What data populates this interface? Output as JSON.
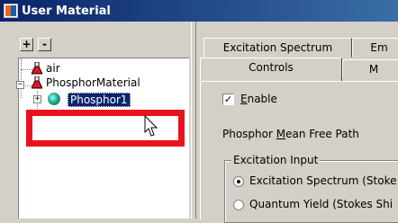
{
  "window": {
    "title": "User Material"
  },
  "tree_toolbar": {
    "expand_label": "+",
    "collapse_label": "-"
  },
  "tree": {
    "items": [
      {
        "label": "air"
      },
      {
        "label": "PhosphorMaterial"
      },
      {
        "label": "Phosphor1",
        "selected": true
      }
    ]
  },
  "tabs": {
    "row1": [
      "Excitation Spectrum",
      "Em"
    ],
    "row2": [
      "Controls",
      "M"
    ]
  },
  "controls": {
    "enable_label_prefix": "",
    "enable_label_accel": "E",
    "enable_label_rest": "nable",
    "enable_checked": true,
    "mfp_prefix": "Phosphor ",
    "mfp_accel": "M",
    "mfp_rest": "ean Free Path",
    "excitation_group_label": "Excitation Input",
    "radio_options": [
      {
        "label": "Excitation Spectrum (Stoke",
        "selected": true
      },
      {
        "label": "Quantum Yield (Stokes Shi",
        "selected": false
      }
    ]
  },
  "colors": {
    "title_bg": "#0a246a",
    "highlight": "#e8131e",
    "selection": "#0a246a"
  }
}
